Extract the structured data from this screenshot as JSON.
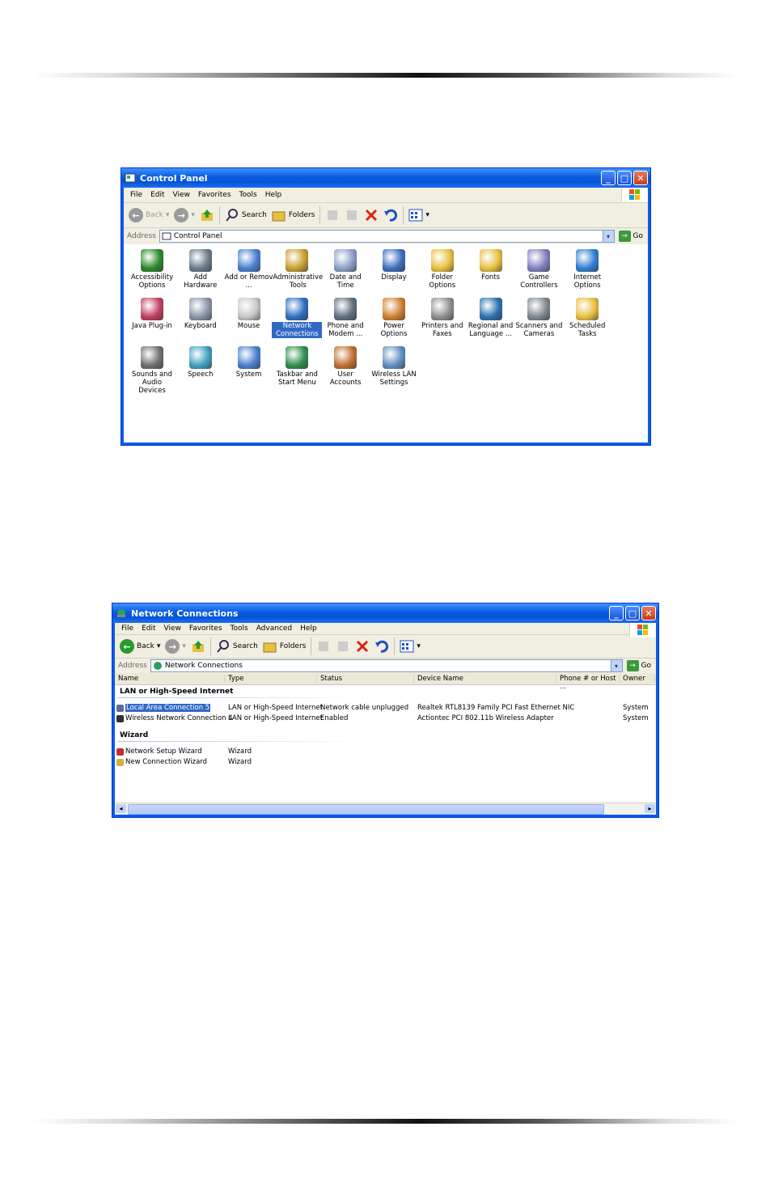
{
  "window1": {
    "title": "Control Panel",
    "menu": [
      "File",
      "Edit",
      "View",
      "Favorites",
      "Tools",
      "Help"
    ],
    "toolbar": {
      "back": "Back",
      "search": "Search",
      "folders": "Folders"
    },
    "address_label": "Address",
    "address_value": "Control Panel",
    "go": "Go",
    "items": [
      {
        "label": "Accessibility Options",
        "icon": "accessibility-icon",
        "color": "#2a8a2a"
      },
      {
        "label": "Add Hardware",
        "icon": "add-hardware-icon",
        "color": "#6b7c8a"
      },
      {
        "label": "Add or Remov ...",
        "icon": "add-remove-programs-icon",
        "color": "#4a7fd0"
      },
      {
        "label": "Administrative Tools",
        "icon": "administrative-tools-icon",
        "color": "#c8a030"
      },
      {
        "label": "Date and Time",
        "icon": "date-time-icon",
        "color": "#8aa0c8"
      },
      {
        "label": "Display",
        "icon": "display-icon",
        "color": "#3c6fbf"
      },
      {
        "label": "Folder Options",
        "icon": "folder-options-icon",
        "color": "#e8c040"
      },
      {
        "label": "Fonts",
        "icon": "fonts-icon",
        "color": "#e8c040"
      },
      {
        "label": "Game Controllers",
        "icon": "game-controllers-icon",
        "color": "#8080c0"
      },
      {
        "label": "Internet Options",
        "icon": "internet-options-icon",
        "color": "#2f7fd0"
      },
      {
        "label": "Java Plug-in",
        "icon": "java-plugin-icon",
        "color": "#c04060"
      },
      {
        "label": "Keyboard",
        "icon": "keyboard-icon",
        "color": "#8a94a8"
      },
      {
        "label": "Mouse",
        "icon": "mouse-icon",
        "color": "#c8c8c8"
      },
      {
        "label": "Network Connections",
        "icon": "network-connections-icon",
        "color": "#2f6fc0"
      },
      {
        "label": "Phone and Modem ...",
        "icon": "phone-modem-icon",
        "color": "#607080"
      },
      {
        "label": "Power Options",
        "icon": "power-options-icon",
        "color": "#d08030"
      },
      {
        "label": "Printers and Faxes",
        "icon": "printers-faxes-icon",
        "color": "#909090"
      },
      {
        "label": "Regional and Language ...",
        "icon": "regional-language-icon",
        "color": "#2a70b0"
      },
      {
        "label": "Scanners and Cameras",
        "icon": "scanners-cameras-icon",
        "color": "#808890"
      },
      {
        "label": "Scheduled Tasks",
        "icon": "scheduled-tasks-icon",
        "color": "#e8c040"
      },
      {
        "label": "Sounds and Audio Devices",
        "icon": "sounds-audio-icon",
        "color": "#707070"
      },
      {
        "label": "Speech",
        "icon": "speech-icon",
        "color": "#40a0c0"
      },
      {
        "label": "System",
        "icon": "system-icon",
        "color": "#4a7fd0"
      },
      {
        "label": "Taskbar and Start Menu",
        "icon": "taskbar-start-menu-icon",
        "color": "#2f8f4f"
      },
      {
        "label": "User Accounts",
        "icon": "user-accounts-icon",
        "color": "#c07030"
      },
      {
        "label": "Wireless LAN Settings",
        "icon": "wireless-lan-icon",
        "color": "#6090c0"
      }
    ],
    "selected_index": 13
  },
  "window2": {
    "title": "Network Connections",
    "menu": [
      "File",
      "Edit",
      "View",
      "Favorites",
      "Tools",
      "Advanced",
      "Help"
    ],
    "toolbar": {
      "back": "Back",
      "search": "Search",
      "folders": "Folders"
    },
    "address_label": "Address",
    "address_value": "Network Connections",
    "go": "Go",
    "columns": [
      "Name",
      "Type",
      "Status",
      "Device Name",
      "Phone # or Host ...",
      "Owner"
    ],
    "groups": [
      {
        "title": "LAN or High-Speed Internet",
        "rows": [
          {
            "name": "Local Area Connection 5",
            "type": "LAN or High-Speed Internet",
            "status": "Network cable unplugged",
            "device": "Realtek RTL8139 Family PCI Fast Ethernet NIC",
            "phone": "",
            "owner": "System",
            "selected": true,
            "icon": "lan-connection-icon"
          },
          {
            "name": "Wireless Network Connection 4",
            "type": "LAN or High-Speed Internet",
            "status": "Enabled",
            "device": "Actiontec PCI 802.11b Wireless Adapter",
            "phone": "",
            "owner": "System",
            "selected": false,
            "icon": "wireless-connection-icon"
          }
        ]
      },
      {
        "title": "Wizard",
        "rows": [
          {
            "name": "Network Setup Wizard",
            "type": "Wizard",
            "status": "",
            "device": "",
            "phone": "",
            "owner": "",
            "selected": false,
            "icon": "network-setup-wizard-icon"
          },
          {
            "name": "New Connection Wizard",
            "type": "Wizard",
            "status": "",
            "device": "",
            "phone": "",
            "owner": "",
            "selected": false,
            "icon": "new-connection-wizard-icon"
          }
        ]
      }
    ]
  }
}
